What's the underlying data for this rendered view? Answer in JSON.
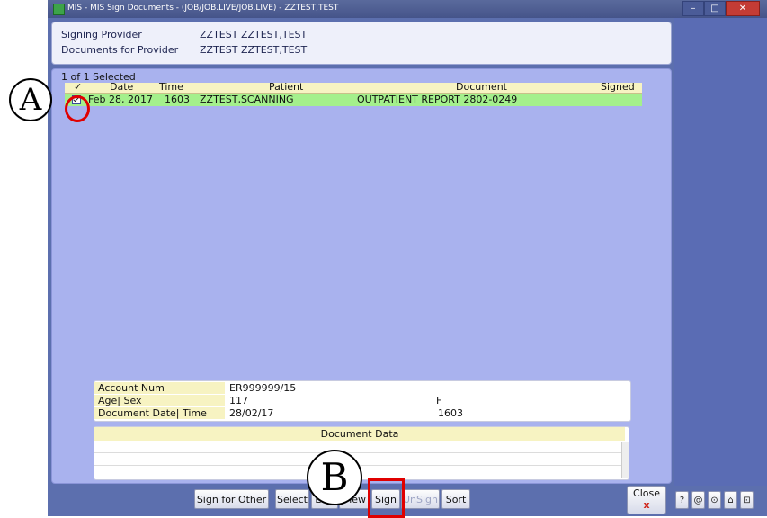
{
  "window": {
    "title": "MIS - MIS Sign Documents - (JOB/JOB.LIVE/JOB.LIVE) - ZZTEST,TEST",
    "controls": [
      "–",
      "□",
      "✕"
    ]
  },
  "header": {
    "signing_provider_label": "Signing Provider",
    "signing_provider_value": "ZZTEST  ZZTEST,TEST",
    "documents_for_label": "Documents for Provider",
    "documents_for_value": "ZZTEST  ZZTEST,TEST"
  },
  "grid": {
    "selected_count": "1 of 1 Selected",
    "columns": {
      "check": "✓",
      "date": "Date",
      "time": "Time",
      "patient": "Patient",
      "document": "Document",
      "signed": "Signed"
    },
    "rows": [
      {
        "checked": true,
        "date": "Feb 28, 2017",
        "time": "1603",
        "patient": "ZZTEST,SCANNING",
        "document": "OUTPATIENT REPORT 2802-0249",
        "signed": ""
      }
    ]
  },
  "info": {
    "account_num_label": "Account Num",
    "account_num_value": "ER999999/15",
    "age_sex_label": "Age| Sex",
    "age_value": "117",
    "sex_value": "F",
    "doc_date_time_label": "Document Date| Time",
    "doc_date_value": "28/02/17",
    "doc_time_value": "1603"
  },
  "document_data": {
    "title": "Document Data"
  },
  "toolbar": {
    "sign_for_other": "Sign for Other",
    "select": "Select",
    "edit": "Edit",
    "view": "View",
    "sign": "Sign",
    "unsign": "UnSign",
    "sort": "Sort",
    "close": "Close",
    "close_symbol": "x"
  },
  "icons": {
    "help": "?",
    "at": "@",
    "circle": "⊙",
    "home": "⌂",
    "misc": "⊡"
  },
  "annotations": {
    "a": "A",
    "b": "B"
  },
  "colors": {
    "background": "#5c6fae",
    "panel": "#a9b2ee",
    "header_yellow": "#f7f3c2",
    "selected_row": "#a4f08c",
    "highlight": "#e00000"
  }
}
